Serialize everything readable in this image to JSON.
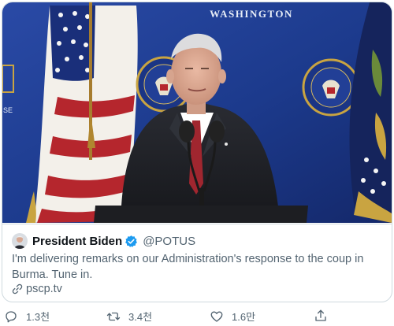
{
  "media": {
    "backdrop_text": "WASHINGTON",
    "side_letters": "SE"
  },
  "tweet": {
    "author_name": "President Biden",
    "author_handle": "@POTUS",
    "text": "I'm delivering remarks on our Administration's response to the coup in Burma. Tune in.",
    "link_label": "pscp.tv"
  },
  "actions": {
    "replies": "1.3천",
    "retweets": "3.4천",
    "likes": "1.6만"
  },
  "colors": {
    "backdrop_blue": "#1c3a8c",
    "verified_blue": "#1d9bf0",
    "muted_text": "#536471"
  }
}
